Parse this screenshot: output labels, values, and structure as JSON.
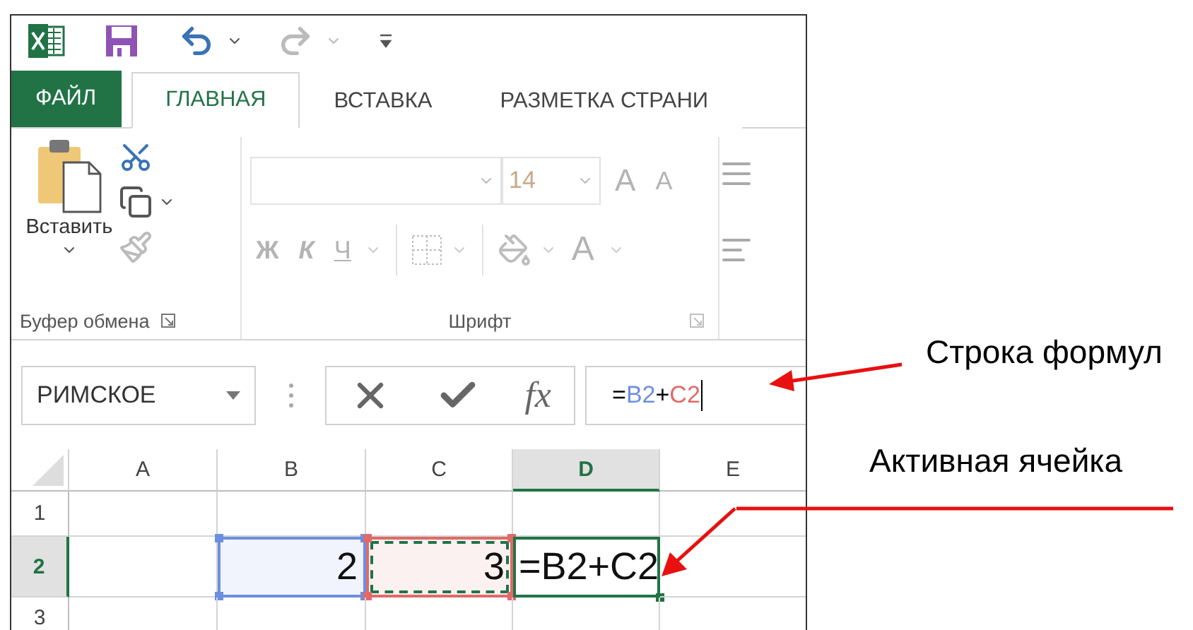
{
  "tabs": [
    {
      "label": "ФАЙЛ",
      "kind": "file",
      "selected": false
    },
    {
      "label": "ГЛАВНАЯ",
      "kind": "tab",
      "selected": true
    },
    {
      "label": "ВСТАВКА",
      "kind": "tab",
      "selected": false
    },
    {
      "label": "РАЗМЕТКА СТРАНИ",
      "kind": "tab",
      "selected": false
    }
  ],
  "clipboard": {
    "paste_label": "Вставить",
    "group_label": "Буфер обмена"
  },
  "font": {
    "disabled": true,
    "size": "14",
    "grow": "A",
    "shrink": "A",
    "bold": "Ж",
    "italic": "К",
    "underline": "Ч",
    "font_color": "A",
    "group_label": "Шрифт"
  },
  "name_box": "РИМСКОЕ",
  "formula_bar": {
    "function_label": "fx",
    "tokens": [
      {
        "text": "=",
        "color": "#000000"
      },
      {
        "text": "B2",
        "color": "#6d8fe0"
      },
      {
        "text": "+",
        "color": "#000000"
      },
      {
        "text": "C2",
        "color": "#e06a6a"
      }
    ]
  },
  "columns": [
    {
      "label": "A",
      "selected": false
    },
    {
      "label": "B",
      "selected": false
    },
    {
      "label": "C",
      "selected": false
    },
    {
      "label": "D",
      "selected": true
    },
    {
      "label": "E",
      "selected": false
    }
  ],
  "rows": [
    {
      "label": "1",
      "selected": false,
      "cells": [
        {
          "kind": "empty"
        },
        {
          "kind": "empty"
        },
        {
          "kind": "empty"
        },
        {
          "kind": "empty"
        },
        {
          "kind": "empty"
        }
      ]
    },
    {
      "label": "2",
      "selected": true,
      "cells": [
        {
          "kind": "empty"
        },
        {
          "kind": "ref",
          "text": "2",
          "color": "#6d8fe0",
          "marquee": false
        },
        {
          "kind": "ref",
          "text": "3",
          "color": "#e06a6a",
          "marquee": true
        },
        {
          "kind": "active",
          "text": "=B2+C2"
        },
        {
          "kind": "empty"
        }
      ]
    },
    {
      "label": "3",
      "selected": false,
      "cells": [
        {
          "kind": "empty"
        },
        {
          "kind": "empty"
        },
        {
          "kind": "empty"
        },
        {
          "kind": "empty"
        },
        {
          "kind": "empty"
        }
      ]
    }
  ],
  "annotations": [
    {
      "text": "Строка формул"
    },
    {
      "text": "Активная ячейка"
    }
  ]
}
